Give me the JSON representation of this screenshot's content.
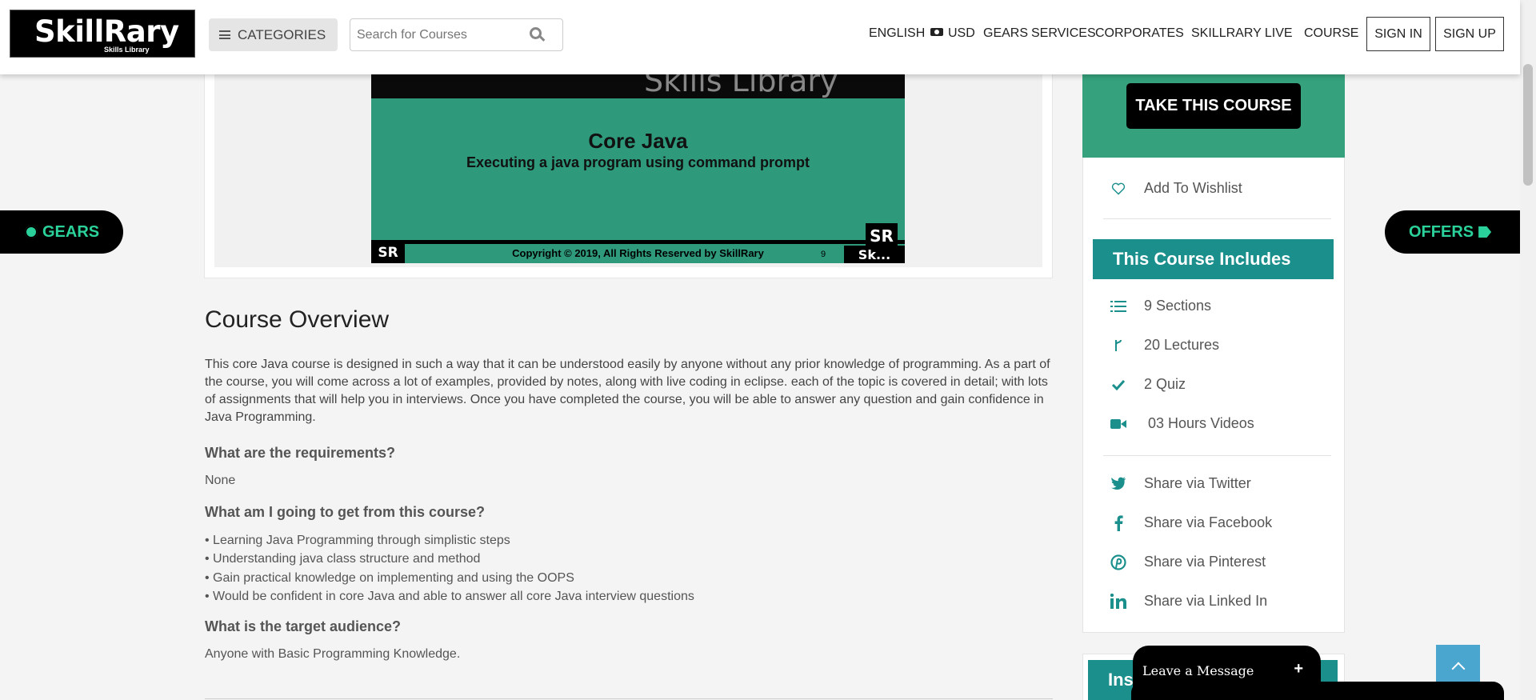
{
  "header": {
    "logo_main": "SkillRary",
    "logo_sub": "Skills Library",
    "categories_label": "CATEGORIES",
    "search_placeholder": "Search for Courses",
    "nav": [
      "ENGLISH",
      "USD",
      "GEARS",
      "SERVICES",
      "CORPORATES",
      "SKILLRARY LIVE",
      "COURSE"
    ],
    "sign_in": "SIGN IN",
    "sign_up": "SIGN UP"
  },
  "side_tabs": {
    "gears": "GEARS",
    "offers": "OFFERS"
  },
  "video": {
    "top_text": "Skills Library",
    "title": "Core Java",
    "subtitle": "Executing a java program using command prompt",
    "copyright": "Copyright © 2019, All Rights Reserved by SkillRary",
    "slide_number": "9",
    "badge_left": "SR",
    "badge_right": "SR",
    "badge_bottom": "Sk..."
  },
  "overview": {
    "title": "Course Overview",
    "description": "This core Java course is designed in such a way that it can be understood easily by anyone without any prior knowledge of programming. As a part of the course, you will come across a lot of examples, provided by notes, along with live coding in eclipse. each of the topic is covered in detail; with lots of assignments that will help you in interviews. Once you have completed the course, you will be able to answer any question and gain confidence in Java Programming.",
    "requirements_heading": "What are the requirements?",
    "requirements": "None",
    "get_heading": "What am I going to get from this course?",
    "get_items": [
      "• Learning Java Programming through simplistic steps",
      "• Understanding java class structure and method",
      "• Gain practical knowledge on implementing and using the OOPS",
      "• Would be confident in core Java and able to answer all core Java interview questions"
    ],
    "audience_heading": "What is the target audience?",
    "audience": "Anyone with Basic Programming Knowledge."
  },
  "sidebar": {
    "take_course": "TAKE THIS COURSE",
    "wishlist": "Add To Wishlist",
    "includes_title": "This Course Includes",
    "includes": [
      "9 Sections",
      "20 Lectures",
      "2 Quiz",
      "03 Hours Videos"
    ],
    "shares": [
      "Share via Twitter",
      "Share via Facebook",
      "Share via Pinterest",
      "Share via Linked In"
    ],
    "instructor_partial": "Ins"
  },
  "chat": {
    "label": "Leave a Message",
    "plus": "+"
  },
  "colors": {
    "brand_green": "#35a27d",
    "teal": "#1a8f8c",
    "accent_green": "#2bd19b",
    "scroll_top_blue": "#4aa5cf"
  }
}
